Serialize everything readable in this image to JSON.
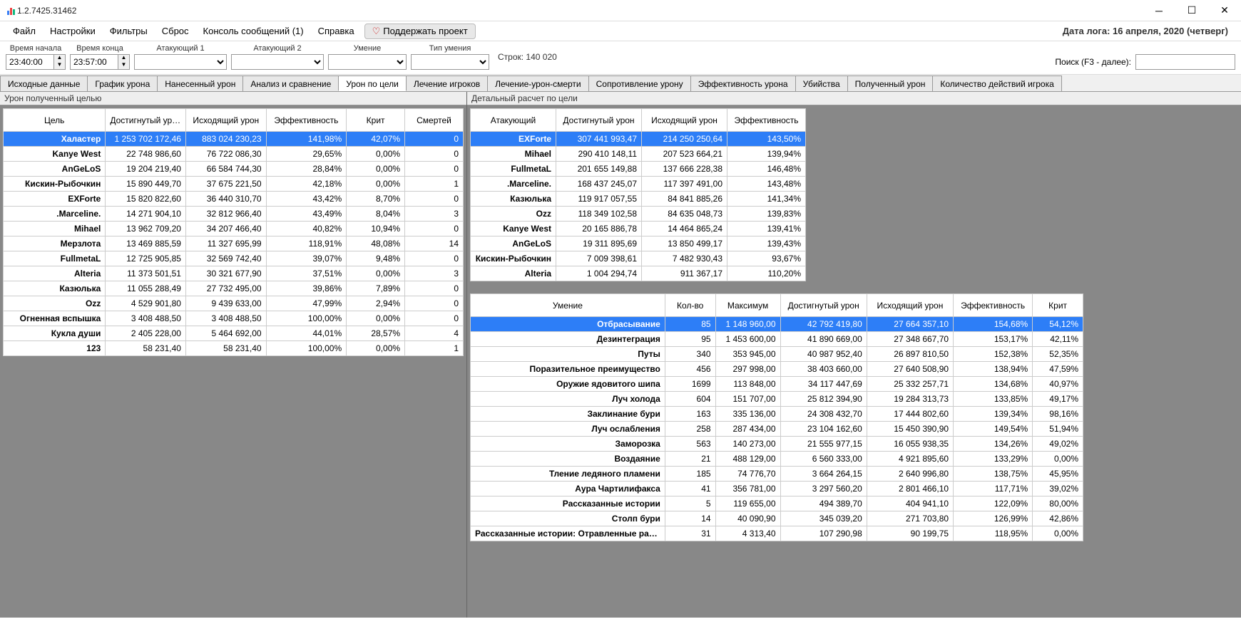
{
  "window": {
    "title": "1.2.7425.31462"
  },
  "menu": {
    "file": "Файл",
    "settings": "Настройки",
    "filters": "Фильтры",
    "reset": "Сброс",
    "console": "Консоль сообщений (1)",
    "help": "Справка",
    "support": "Поддержать проект",
    "logdate_prefix": "Дата лога:",
    "logdate_value": "16 апреля, 2020  (четверг)"
  },
  "filters": {
    "start_label": "Время начала",
    "start_value": "23:40:00",
    "end_label": "Время конца",
    "end_value": "23:57:00",
    "attacker1_label": "Атакующий 1",
    "attacker2_label": "Атакующий 2",
    "skill_label": "Умение",
    "skilltype_label": "Тип умения",
    "rowcount": "Строк: 140 020",
    "search_label": "Поиск (F3 - далее):"
  },
  "tabs": [
    "Исходные данные",
    "График урона",
    "Нанесенный урон",
    "Анализ и сравнение",
    "Урон по цели",
    "Лечение игроков",
    "Лечение-урон-смерти",
    "Сопротивление урону",
    "Эффективность урона",
    "Убийства",
    "Полученный урон",
    "Количество действий игрока"
  ],
  "tabs_active_index": 4,
  "left_panel_title": "Урон полученный целью",
  "right_upper_title": "Детальный расчет по цели",
  "left_table": {
    "headers": [
      "Цель",
      "Достигнутый урон",
      "Исходящий урон",
      "Эффективность",
      "Крит",
      "Смертей"
    ],
    "widths": [
      140,
      110,
      110,
      110,
      80,
      80
    ],
    "selected_index": 0,
    "rows": [
      [
        "Халастер",
        "1 253 702 172,46",
        "883 024 230,23",
        "141,98%",
        "42,07%",
        "0"
      ],
      [
        "Kanye West",
        "22 748 986,60",
        "76 722 086,30",
        "29,65%",
        "0,00%",
        "0"
      ],
      [
        "AnGeLoS",
        "19 204 219,40",
        "66 584 744,30",
        "28,84%",
        "0,00%",
        "0"
      ],
      [
        "Кискин-Рыбочкин",
        "15 890 449,70",
        "37 675 221,50",
        "42,18%",
        "0,00%",
        "1"
      ],
      [
        "EXForte",
        "15 820 822,60",
        "36 440 310,70",
        "43,42%",
        "8,70%",
        "0"
      ],
      [
        ".Marceline.",
        "14 271 904,10",
        "32 812 966,40",
        "43,49%",
        "8,04%",
        "3"
      ],
      [
        "Mihael",
        "13 962 709,20",
        "34 207 466,40",
        "40,82%",
        "10,94%",
        "0"
      ],
      [
        "Мерзлота",
        "13 469 885,59",
        "11 327 695,99",
        "118,91%",
        "48,08%",
        "14"
      ],
      [
        "FullmetaL",
        "12 725 905,85",
        "32 569 742,40",
        "39,07%",
        "9,48%",
        "0"
      ],
      [
        "Alteria",
        "11 373 501,51",
        "30 321 677,90",
        "37,51%",
        "0,00%",
        "3"
      ],
      [
        "Казюлька",
        "11 055 288,49",
        "27 732 495,00",
        "39,86%",
        "7,89%",
        "0"
      ],
      [
        "Ozz",
        "4 529 901,80",
        "9 439 633,00",
        "47,99%",
        "2,94%",
        "0"
      ],
      [
        "Огненная вспышка",
        "3 408 488,50",
        "3 408 488,50",
        "100,00%",
        "0,00%",
        "0"
      ],
      [
        "Кукла души",
        "2 405 228,00",
        "5 464 692,00",
        "44,01%",
        "28,57%",
        "4"
      ],
      [
        "123",
        "58 231,40",
        "58 231,40",
        "100,00%",
        "0,00%",
        "1"
      ]
    ]
  },
  "right_upper_table": {
    "headers": [
      "Атакующий",
      "Достигнутый урон",
      "Исходящий урон",
      "Эффективность"
    ],
    "widths": [
      120,
      120,
      120,
      110
    ],
    "selected_index": 0,
    "rows": [
      [
        "EXForte",
        "307 441 993,47",
        "214 250 250,64",
        "143,50%"
      ],
      [
        "Mihael",
        "290 410 148,11",
        "207 523 664,21",
        "139,94%"
      ],
      [
        "FullmetaL",
        "201 655 149,88",
        "137 666 228,38",
        "146,48%"
      ],
      [
        ".Marceline.",
        "168 437 245,07",
        "117 397 491,00",
        "143,48%"
      ],
      [
        "Казюлька",
        "119 917 057,55",
        "84 841 885,26",
        "141,34%"
      ],
      [
        "Ozz",
        "118 349 102,58",
        "84 635 048,73",
        "139,83%"
      ],
      [
        "Kanye West",
        "20 165 886,78",
        "14 464 865,24",
        "139,41%"
      ],
      [
        "AnGeLoS",
        "19 311 895,69",
        "13 850 499,17",
        "139,43%"
      ],
      [
        "Кискин-Рыбочкин",
        "7 009 398,61",
        "7 482 930,43",
        "93,67%"
      ],
      [
        "Alteria",
        "1 004 294,74",
        "911 367,17",
        "110,20%"
      ]
    ]
  },
  "right_lower_table": {
    "headers": [
      "Умение",
      "Кол-во",
      "Максимум",
      "Достигнутый урон",
      "Исходящий урон",
      "Эффективность",
      "Крит"
    ],
    "widths": [
      270,
      70,
      90,
      120,
      120,
      110,
      70
    ],
    "selected_index": 0,
    "rows": [
      [
        "Отбрасывание",
        "85",
        "1 148 960,00",
        "42 792 419,80",
        "27 664 357,10",
        "154,68%",
        "54,12%"
      ],
      [
        "Дезинтеграция",
        "95",
        "1 453 600,00",
        "41 890 669,00",
        "27 348 667,70",
        "153,17%",
        "42,11%"
      ],
      [
        "Путы",
        "340",
        "353 945,00",
        "40 987 952,40",
        "26 897 810,50",
        "152,38%",
        "52,35%"
      ],
      [
        "Поразительное преимущество",
        "456",
        "297 998,00",
        "38 403 660,00",
        "27 640 508,90",
        "138,94%",
        "47,59%"
      ],
      [
        "Оружие ядовитого шипа",
        "1699",
        "113 848,00",
        "34 117 447,69",
        "25 332 257,71",
        "134,68%",
        "40,97%"
      ],
      [
        "Луч холода",
        "604",
        "151 707,00",
        "25 812 394,90",
        "19 284 313,73",
        "133,85%",
        "49,17%"
      ],
      [
        "Заклинание бури",
        "163",
        "335 136,00",
        "24 308 432,70",
        "17 444 802,60",
        "139,34%",
        "98,16%"
      ],
      [
        "Луч ослабления",
        "258",
        "287 434,00",
        "23 104 162,60",
        "15 450 390,90",
        "149,54%",
        "51,94%"
      ],
      [
        "Заморозка",
        "563",
        "140 273,00",
        "21 555 977,15",
        "16 055 938,35",
        "134,26%",
        "49,02%"
      ],
      [
        "Воздаяние",
        "21",
        "488 129,00",
        "6 560 333,00",
        "4 921 895,60",
        "133,29%",
        "0,00%"
      ],
      [
        "Тление ледяного пламени",
        "185",
        "74 776,70",
        "3 664 264,15",
        "2 640 996,80",
        "138,75%",
        "45,95%"
      ],
      [
        "Аура Чартилифакса",
        "41",
        "356 781,00",
        "3 297 560,20",
        "2 801 466,10",
        "117,71%",
        "39,02%"
      ],
      [
        "Рассказанные истории",
        "5",
        "119 655,00",
        "494 389,70",
        "404 941,10",
        "122,09%",
        "80,00%"
      ],
      [
        "Столп бури",
        "14",
        "40 090,90",
        "345 039,20",
        "271 703,80",
        "126,99%",
        "42,86%"
      ],
      [
        "Рассказанные истории: Отравленные рассказы",
        "31",
        "4 313,40",
        "107 290,98",
        "90 199,75",
        "118,95%",
        "0,00%"
      ]
    ]
  }
}
